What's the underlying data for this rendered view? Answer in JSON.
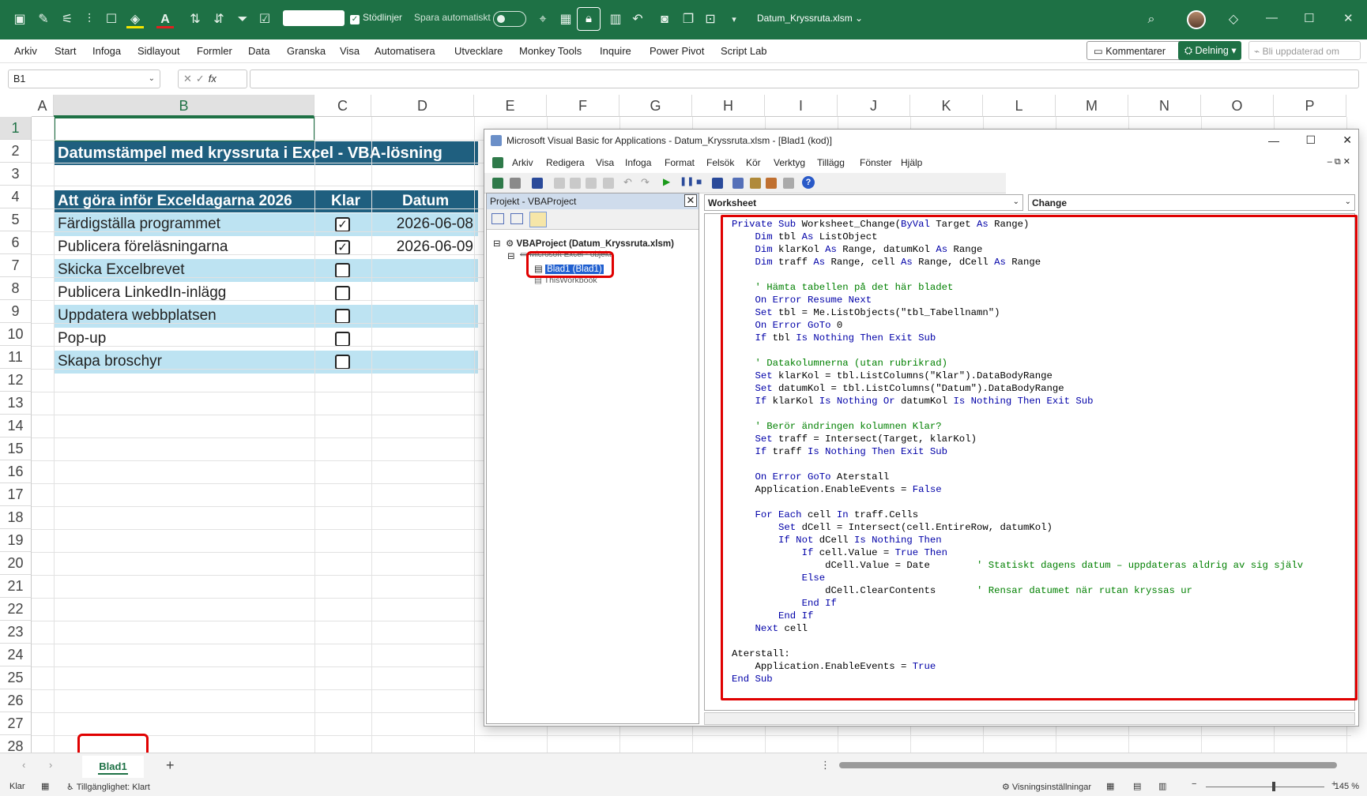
{
  "titlebar": {
    "stodlinjer": "Stödlinjer",
    "spara": "Spara automatiskt",
    "doc_title": "Datum_Kryssruta.xlsm"
  },
  "menu": [
    "Arkiv",
    "Start",
    "Infoga",
    "Sidlayout",
    "Formler",
    "Data",
    "Granska",
    "Visa",
    "Automatisera",
    "Utvecklare",
    "Monkey Tools",
    "Inquire",
    "Power Pivot",
    "Script Lab"
  ],
  "actions": {
    "kommentarer": "Kommentarer",
    "delning": "Delning",
    "bli": "Bli uppdaterad om"
  },
  "formula_bar": {
    "namebox": "B1",
    "fx": "fx",
    "formula": ""
  },
  "columns": [
    "A",
    "B",
    "C",
    "D",
    "E",
    "F",
    "G",
    "H",
    "I",
    "J",
    "K",
    "L",
    "M",
    "N",
    "O",
    "P"
  ],
  "rows": [
    "1",
    "2",
    "3",
    "4",
    "5",
    "6",
    "7",
    "8",
    "9",
    "10",
    "11",
    "12",
    "13",
    "14",
    "15",
    "16",
    "17",
    "18",
    "19",
    "20",
    "21",
    "22",
    "23",
    "24",
    "25",
    "26",
    "27",
    "28"
  ],
  "sheet": {
    "title": "Datumstämpel med kryssruta i Excel - VBA-lösning",
    "headers": [
      "Att göra inför Exceldagarna 2026",
      "Klar",
      "Datum"
    ],
    "tasks": [
      {
        "task": "Färdigställa programmet",
        "checked": true,
        "date": "2026-06-08"
      },
      {
        "task": "Publicera föreläsningarna",
        "checked": true,
        "date": "2026-06-09"
      },
      {
        "task": "Skicka Excelbrevet",
        "checked": false,
        "date": ""
      },
      {
        "task": "Publicera LinkedIn-inlägg",
        "checked": false,
        "date": ""
      },
      {
        "task": "Uppdatera webbplatsen",
        "checked": false,
        "date": ""
      },
      {
        "task": "Pop-up",
        "checked": false,
        "date": ""
      },
      {
        "task": "Skapa broschyr",
        "checked": false,
        "date": ""
      }
    ]
  },
  "tabs": {
    "sheet1": "Blad1",
    "add": "+"
  },
  "status": {
    "ready": "Klar",
    "access": "Tillgänglighet: Klart",
    "view": "Visningsinställningar",
    "zoom": "145 %"
  },
  "vba": {
    "title": "Microsoft Visual Basic for Applications - Datum_Kryssruta.xlsm - [Blad1 (kod)]",
    "menu": [
      "Arkiv",
      "Redigera",
      "Visa",
      "Infoga",
      "Format",
      "Felsök",
      "Kör",
      "Verktyg",
      "Tillägg",
      "Fönster",
      "Hjälp"
    ],
    "project_title": "Projekt - VBAProject",
    "tree": {
      "root": "VBAProject (Datum_Kryssruta.xlsm)",
      "folder": "Microsoft Excel - objekt",
      "sheet": "Blad1 (Blad1)",
      "workbook": "ThisWorkbook"
    },
    "object_combo": "Worksheet",
    "proc_combo": "Change"
  }
}
